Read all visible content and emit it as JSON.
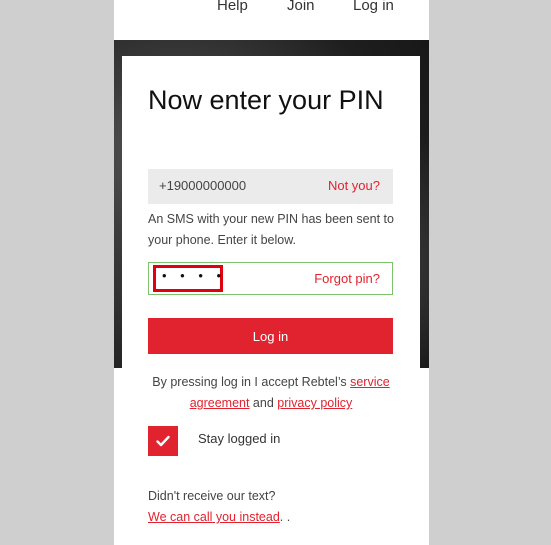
{
  "nav": {
    "help": "Help",
    "join": "Join",
    "login": "Log in"
  },
  "form": {
    "heading": "Now enter your PIN",
    "phone_number": "+19000000000",
    "not_you": "Not you?",
    "sms_message": "An SMS with your new PIN has been sent to your phone. Enter it below.",
    "pin_masked": "• • • •",
    "forgot_pin": "Forgot pin?",
    "login_button": "Log in",
    "terms_prefix": "By pressing log in I accept Rebtel’s ",
    "service_agreement": "service agreement",
    "terms_and": " and ",
    "privacy_policy": "privacy policy",
    "stay_logged_in": "Stay logged in",
    "stay_logged_in_checked": true,
    "didnt_receive": "Didn't receive our text?",
    "call_instead": "We can call you instead",
    "call_suffix": ". ."
  },
  "colors": {
    "accent": "#e0232f",
    "pin_border": "#7cc36b",
    "highlight": "#e0000f",
    "page_bg": "#cfcfcf"
  },
  "icons": {
    "checkbox": "checkmark-icon"
  }
}
